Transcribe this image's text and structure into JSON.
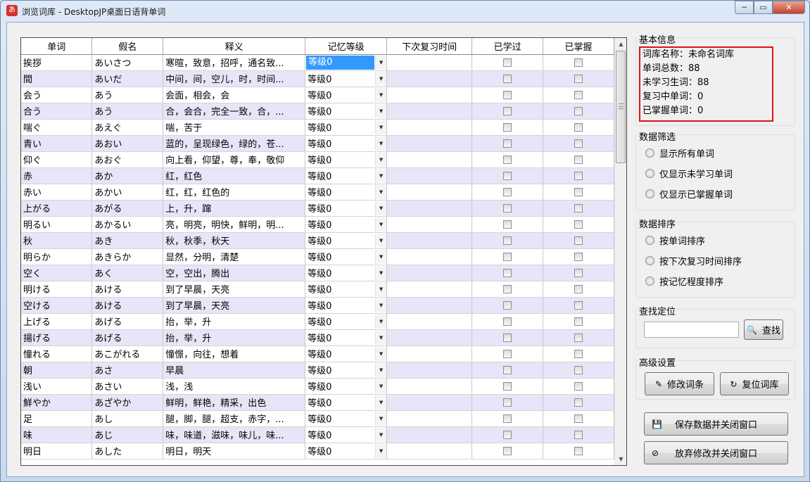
{
  "window": {
    "title": "浏览词库 - DesktopJP桌面日语背单词",
    "app_icon": "あ",
    "minimize": "─",
    "maximize": "▭",
    "close": "✕"
  },
  "grid": {
    "columns": [
      "单词",
      "假名",
      "释义",
      "记忆等级",
      "下次复习时间",
      "已学过",
      "已掌握"
    ],
    "rows": [
      {
        "word": "挨拶",
        "kana": "あいさつ",
        "meaning": "寒暄，致意，招呼，通名致...",
        "level": "等级0",
        "next": "",
        "learned": false,
        "mastered": false
      },
      {
        "word": "間",
        "kana": "あいだ",
        "meaning": "中间，间，空儿，时，时间...",
        "level": "等级0",
        "next": "",
        "learned": false,
        "mastered": false
      },
      {
        "word": "会う",
        "kana": "あう",
        "meaning": "会面，相会，会",
        "level": "等级0",
        "next": "",
        "learned": false,
        "mastered": false
      },
      {
        "word": "合う",
        "kana": "あう",
        "meaning": "合，会合，完全一致，合，...",
        "level": "等级0",
        "next": "",
        "learned": false,
        "mastered": false
      },
      {
        "word": "喘ぐ",
        "kana": "あえぐ",
        "meaning": "喘，苦于",
        "level": "等级0",
        "next": "",
        "learned": false,
        "mastered": false
      },
      {
        "word": "青い",
        "kana": "あおい",
        "meaning": "蓝的，呈现绿色，绿的，苍...",
        "level": "等级0",
        "next": "",
        "learned": false,
        "mastered": false
      },
      {
        "word": "仰ぐ",
        "kana": "あおぐ",
        "meaning": "向上看，仰望，尊，奉，敬仰",
        "level": "等级0",
        "next": "",
        "learned": false,
        "mastered": false
      },
      {
        "word": "赤",
        "kana": "あか",
        "meaning": "红，红色",
        "level": "等级0",
        "next": "",
        "learned": false,
        "mastered": false
      },
      {
        "word": "赤い",
        "kana": "あかい",
        "meaning": "红，红，红色的",
        "level": "等级0",
        "next": "",
        "learned": false,
        "mastered": false
      },
      {
        "word": "上がる",
        "kana": "あがる",
        "meaning": "上，升，蹿",
        "level": "等级0",
        "next": "",
        "learned": false,
        "mastered": false
      },
      {
        "word": "明るい",
        "kana": "あかるい",
        "meaning": "亮，明亮，明快，鲜明，明...",
        "level": "等级0",
        "next": "",
        "learned": false,
        "mastered": false
      },
      {
        "word": "秋",
        "kana": "あき",
        "meaning": "秋，秋季，秋天",
        "level": "等级0",
        "next": "",
        "learned": false,
        "mastered": false
      },
      {
        "word": "明らか",
        "kana": "あきらか",
        "meaning": "显然，分明，清楚",
        "level": "等级0",
        "next": "",
        "learned": false,
        "mastered": false
      },
      {
        "word": "空く",
        "kana": "あく",
        "meaning": "空，空出，腾出",
        "level": "等级0",
        "next": "",
        "learned": false,
        "mastered": false
      },
      {
        "word": "明ける",
        "kana": "あける",
        "meaning": "到了早晨，天亮",
        "level": "等级0",
        "next": "",
        "learned": false,
        "mastered": false
      },
      {
        "word": "空ける",
        "kana": "あける",
        "meaning": "到了早晨，天亮",
        "level": "等级0",
        "next": "",
        "learned": false,
        "mastered": false
      },
      {
        "word": "上げる",
        "kana": "あげる",
        "meaning": "抬，举，升",
        "level": "等级0",
        "next": "",
        "learned": false,
        "mastered": false
      },
      {
        "word": "揚げる",
        "kana": "あげる",
        "meaning": "抬，举，升",
        "level": "等级0",
        "next": "",
        "learned": false,
        "mastered": false
      },
      {
        "word": "憧れる",
        "kana": "あこがれる",
        "meaning": "憧憬，向往，想着",
        "level": "等级0",
        "next": "",
        "learned": false,
        "mastered": false
      },
      {
        "word": "朝",
        "kana": "あさ",
        "meaning": "早晨",
        "level": "等级0",
        "next": "",
        "learned": false,
        "mastered": false
      },
      {
        "word": "浅い",
        "kana": "あさい",
        "meaning": "浅，浅",
        "level": "等级0",
        "next": "",
        "learned": false,
        "mastered": false
      },
      {
        "word": "鮮やか",
        "kana": "あざやか",
        "meaning": "鲜明，鲜艳，精采，出色",
        "level": "等级0",
        "next": "",
        "learned": false,
        "mastered": false
      },
      {
        "word": "足",
        "kana": "あし",
        "meaning": "腿，脚，腿，超支，赤字，...",
        "level": "等级0",
        "next": "",
        "learned": false,
        "mastered": false
      },
      {
        "word": "味",
        "kana": "あじ",
        "meaning": "味，味道，滋味，味儿，味...",
        "level": "等级0",
        "next": "",
        "learned": false,
        "mastered": false
      },
      {
        "word": "明日",
        "kana": "あした",
        "meaning": "明日，明天",
        "level": "等级0",
        "next": "",
        "learned": false,
        "mastered": false
      }
    ]
  },
  "info": {
    "title": "基本信息",
    "lines": [
      "词库名称：未命名词库",
      "单词总数：88",
      "未学习生词：88",
      "复习中单词：0",
      "已掌握单词：0"
    ]
  },
  "filter": {
    "title": "数据筛选",
    "options": [
      "显示所有单词",
      "仅显示未学习单词",
      "仅显示已掌握单词"
    ]
  },
  "sort": {
    "title": "数据排序",
    "options": [
      "按单词排序",
      "按下次复习时间排序",
      "按记忆程度排序"
    ]
  },
  "search": {
    "title": "查找定位",
    "value": "",
    "button": "查找"
  },
  "advanced": {
    "title": "高级设置",
    "edit_button": "修改词条",
    "reset_button": "复位词库"
  },
  "actions": {
    "save_close": "保存数据并关闭窗口",
    "discard_close": "放弃修改并关闭窗口"
  }
}
